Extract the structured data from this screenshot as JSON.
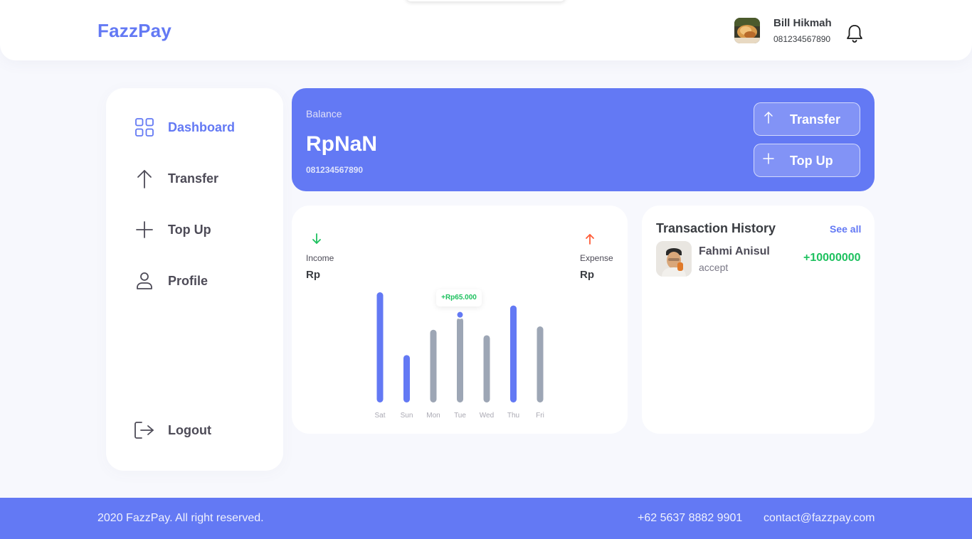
{
  "header": {
    "logo": "FazzPay",
    "user_name": "Bill Hikmah",
    "user_phone": "081234567890"
  },
  "sidebar": {
    "items": [
      {
        "label": "Dashboard",
        "icon": "grid-icon",
        "active": true
      },
      {
        "label": "Transfer",
        "icon": "arrow-up-icon",
        "active": false
      },
      {
        "label": "Top Up",
        "icon": "plus-icon",
        "active": false
      },
      {
        "label": "Profile",
        "icon": "user-icon",
        "active": false
      }
    ],
    "logout_label": "Logout"
  },
  "balance": {
    "label": "Balance",
    "amount": "RpNaN",
    "phone": "081234567890",
    "transfer_label": "Transfer",
    "topup_label": "Top Up"
  },
  "stats": {
    "income_label": "Income",
    "income_value": "Rp",
    "expense_label": "Expense",
    "expense_value": "Rp",
    "tooltip": "+Rp65.000",
    "income_color": "#1ec15f",
    "expense_color": "#ff5b37"
  },
  "chart_data": {
    "type": "bar",
    "categories": [
      "Sat",
      "Sun",
      "Mon",
      "Tue",
      "Wed",
      "Thu",
      "Fri"
    ],
    "values": [
      100,
      43,
      66,
      77,
      61,
      88,
      69
    ],
    "highlight": [
      true,
      true,
      false,
      false,
      false,
      true,
      false
    ],
    "selected_index": 3,
    "colors": {
      "highlight": "#6379f4",
      "normal": "#9da6b5"
    }
  },
  "history": {
    "title": "Transaction History",
    "see_all": "See all",
    "items": [
      {
        "name": "Fahmi Anisul",
        "status": "accept",
        "amount": "+10000000"
      }
    ]
  },
  "footer": {
    "copyright": "2020 FazzPay. All right reserved.",
    "phone": "+62 5637 8882 9901",
    "email": "contact@fazzpay.com"
  }
}
